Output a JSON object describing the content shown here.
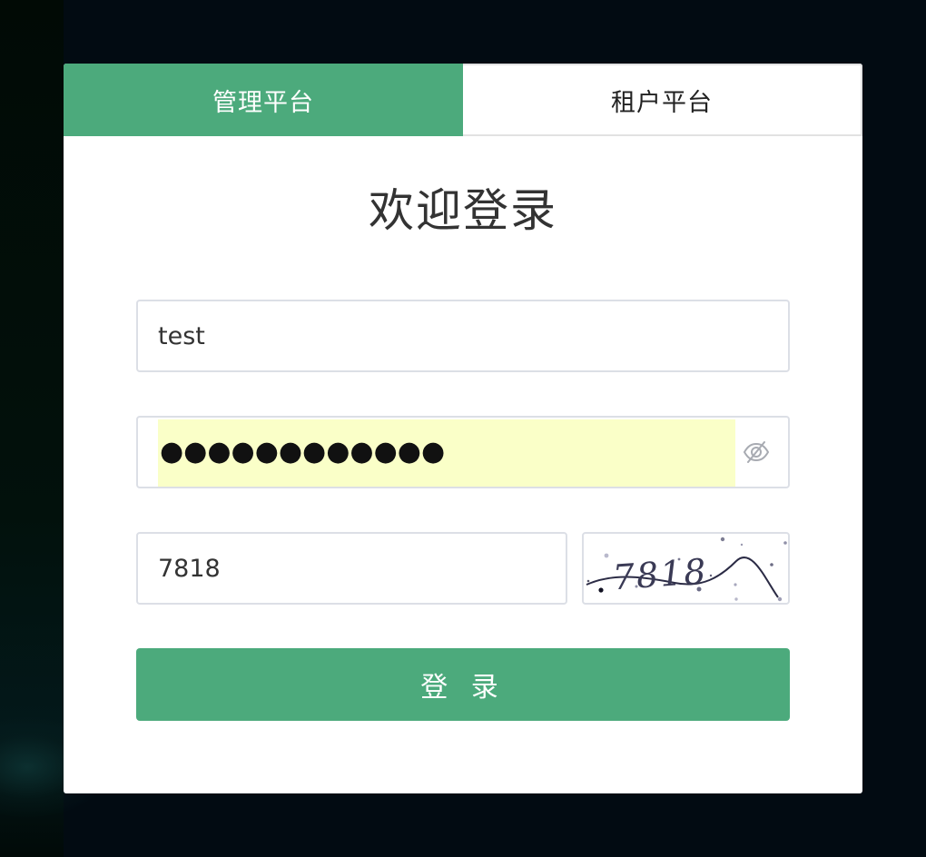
{
  "tabs": {
    "admin": "管理平台",
    "tenant": "租户平台"
  },
  "title": "欢迎登录",
  "username": {
    "value": "test"
  },
  "password": {
    "masked": "●●●●●●●●●●●●"
  },
  "captcha": {
    "value": "7818",
    "image_text": "7818"
  },
  "login_button": "登 录",
  "colors": {
    "accent": "#4caa7c",
    "autofill": "#faffc8",
    "background": "#020b12"
  },
  "icons": {
    "password_toggle": "eye-off-icon"
  }
}
